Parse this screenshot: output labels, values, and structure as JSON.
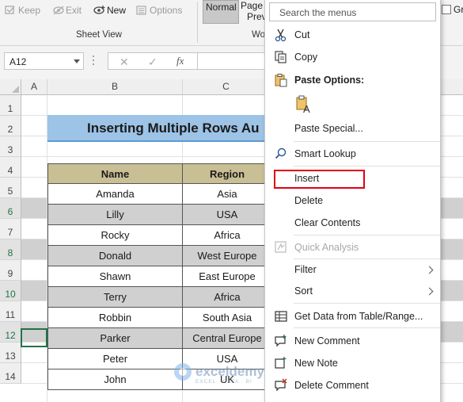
{
  "ribbon": {
    "keep": "Keep",
    "exit": "Exit",
    "new": "New",
    "options": "Options",
    "sheet_view_label": "Sheet View",
    "normal": "Normal",
    "page_line1": "Page",
    "page_line2": "Previ",
    "group2_partial": "Wo",
    "gridlines_partial": "Gri"
  },
  "formula_bar": {
    "name_box": "A12",
    "cancel_glyph": "✕",
    "enter_glyph": "✓",
    "fx": "fx"
  },
  "grid": {
    "columns": [
      "A",
      "B",
      "C"
    ],
    "rows": [
      "1",
      "2",
      "3",
      "4",
      "5",
      "6",
      "7",
      "8",
      "9",
      "10",
      "11",
      "12",
      "13",
      "14"
    ],
    "highlight_rows": [
      "6",
      "8",
      "10",
      "12"
    ],
    "title": "Inserting Multiple Rows Au",
    "table": {
      "headers": [
        "Name",
        "Region"
      ],
      "rows": [
        {
          "name": "Amanda",
          "region": "Asia",
          "shaded": false
        },
        {
          "name": "Lilly",
          "region": "USA",
          "shaded": true
        },
        {
          "name": "Rocky",
          "region": "Africa",
          "shaded": false
        },
        {
          "name": "Donald",
          "region": "West Europe",
          "shaded": true
        },
        {
          "name": "Shawn",
          "region": "East Europe",
          "shaded": false
        },
        {
          "name": "Terry",
          "region": "Africa",
          "shaded": true
        },
        {
          "name": "Robbin",
          "region": "South Asia",
          "shaded": false
        },
        {
          "name": "Parker",
          "region": "Central Europe",
          "shaded": true
        },
        {
          "name": "Peter",
          "region": "USA",
          "shaded": false
        },
        {
          "name": "John",
          "region": "UK",
          "shaded": false
        }
      ]
    }
  },
  "watermark": {
    "brand": "exceldemy",
    "tagline": "EXCEL · DATA · BI"
  },
  "context_menu": {
    "search_placeholder": "Search the menus",
    "cut": "Cut",
    "copy": "Copy",
    "paste_options": "Paste Options:",
    "paste_special": "Paste Special...",
    "smart_lookup": "Smart Lookup",
    "insert": "Insert",
    "delete": "Delete",
    "clear_contents": "Clear Contents",
    "quick_analysis": "Quick Analysis",
    "filter": "Filter",
    "sort": "Sort",
    "get_data": "Get Data from Table/Range...",
    "new_comment": "New Comment",
    "new_note": "New Note",
    "delete_comment": "Delete Comment"
  },
  "colors": {
    "accent_green": "#217346",
    "title_fill": "#9dc3e6",
    "header_fill": "#c9bf95",
    "band_fill": "#d0d0d0",
    "highlight_red": "#e00012"
  }
}
